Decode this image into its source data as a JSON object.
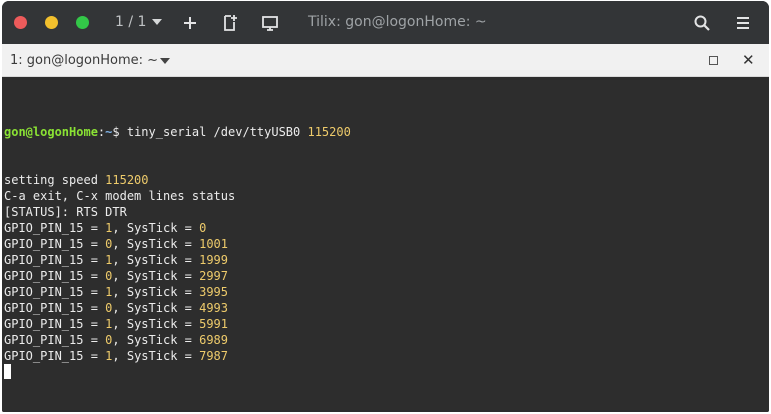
{
  "window": {
    "session_count": "1 / 1",
    "title": "Tilix: gon@logonHome: ~"
  },
  "tab": {
    "label": "1: gon@logonHome: ~"
  },
  "terminal": {
    "prompt_user": "gon@logonHome",
    "prompt_colon": ":",
    "prompt_path": "~",
    "prompt_symbol": "$",
    "command_text": " tiny_serial /dev/ttyUSB0 ",
    "command_baud": "115200",
    "lines": [
      {
        "text": "setting speed ",
        "num": "115200"
      },
      {
        "text": "C-a exit, C-x modem lines status",
        "num": ""
      },
      {
        "text": "[STATUS]: RTS DTR",
        "num": ""
      },
      {
        "text": "GPIO_PIN_15 = ",
        "num": "1",
        "text2": ", SysTick = ",
        "num2": "0"
      },
      {
        "text": "GPIO_PIN_15 = ",
        "num": "0",
        "text2": ", SysTick = ",
        "num2": "1001"
      },
      {
        "text": "GPIO_PIN_15 = ",
        "num": "1",
        "text2": ", SysTick = ",
        "num2": "1999"
      },
      {
        "text": "GPIO_PIN_15 = ",
        "num": "0",
        "text2": ", SysTick = ",
        "num2": "2997"
      },
      {
        "text": "GPIO_PIN_15 = ",
        "num": "1",
        "text2": ", SysTick = ",
        "num2": "3995"
      },
      {
        "text": "GPIO_PIN_15 = ",
        "num": "0",
        "text2": ", SysTick = ",
        "num2": "4993"
      },
      {
        "text": "GPIO_PIN_15 = ",
        "num": "1",
        "text2": ", SysTick = ",
        "num2": "5991"
      },
      {
        "text": "GPIO_PIN_15 = ",
        "num": "0",
        "text2": ", SysTick = ",
        "num2": "6989"
      },
      {
        "text": "GPIO_PIN_15 = ",
        "num": "1",
        "text2": ", SysTick = ",
        "num2": "7987"
      }
    ]
  }
}
